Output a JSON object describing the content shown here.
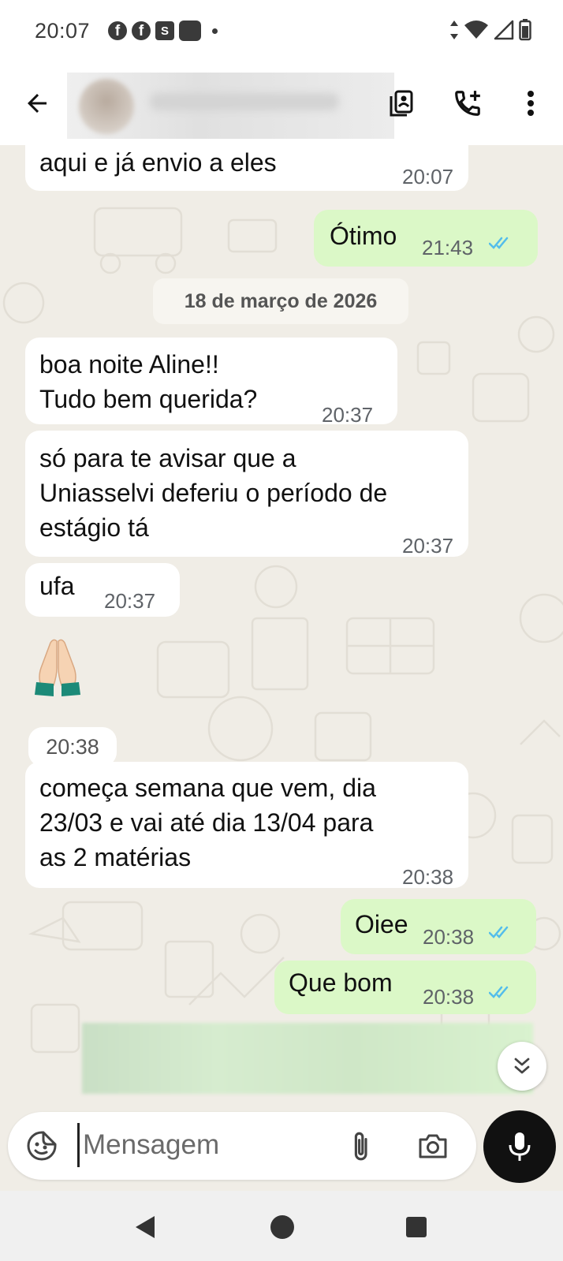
{
  "status_bar": {
    "time": "20:07",
    "notification_icons": [
      "facebook-icon",
      "facebook-icon",
      "shopee-icon",
      "app-icon"
    ],
    "system_icons": [
      "data-arrows-icon",
      "wifi-icon",
      "signal-icon",
      "battery-icon"
    ]
  },
  "header": {
    "back_icon": "arrow-left-icon",
    "contact_name_blurred": true,
    "actions": [
      "contact-card-icon",
      "add-call-icon",
      "more-vert-icon"
    ]
  },
  "chat": {
    "date_separator": "18 de março de 2026",
    "messages": [
      {
        "direction": "in",
        "lines": [
          "aqui e já envio a eles"
        ],
        "time": "20:07"
      },
      {
        "direction": "out",
        "lines": [
          "Ótimo"
        ],
        "time": "21:43",
        "read": true
      },
      {
        "direction": "in",
        "lines": [
          "boa noite Aline!!",
          "Tudo bem querida?"
        ],
        "time": "20:37"
      },
      {
        "direction": "in",
        "lines": [
          "só para te avisar que a",
          "Uniasselvi deferiu o período de",
          "estágio tá"
        ],
        "time": "20:37"
      },
      {
        "direction": "in",
        "lines": [
          "ufa"
        ],
        "time": "20:37"
      },
      {
        "direction": "in",
        "emoji": "🙏",
        "time": "20:38"
      },
      {
        "direction": "in",
        "lines": [
          "começa semana que vem, dia",
          "23/03 e vai até dia 13/04 para",
          "as 2 matérias"
        ],
        "time": "20:38"
      },
      {
        "direction": "out",
        "lines": [
          "Oiee"
        ],
        "time": "20:38",
        "read": true
      },
      {
        "direction": "out",
        "lines": [
          "Que bom"
        ],
        "time": "20:38",
        "read": true
      }
    ]
  },
  "input": {
    "placeholder": "Mensagem",
    "emoji_icon": "sticker-icon",
    "attach_icon": "paperclip-icon",
    "camera_icon": "camera-icon",
    "mic_icon": "microphone-icon"
  },
  "colors": {
    "wallpaper": "#f0ede6",
    "incoming_bubble": "#ffffff",
    "outgoing_bubble": "#dbf8c7",
    "read_ticks": "#53bdeb",
    "mic_button": "#111111"
  }
}
